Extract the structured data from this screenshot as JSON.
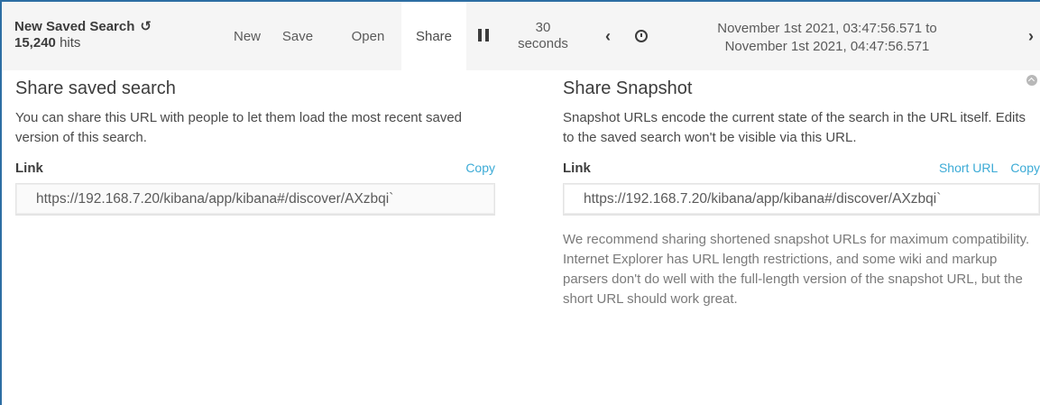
{
  "header": {
    "title": "New Saved Search",
    "hits_count": "15,240",
    "hits_label": "hits",
    "menu": {
      "new": "New",
      "save": "Save",
      "open": "Open",
      "share": "Share"
    },
    "interval_line1": "30",
    "interval_line2": "seconds",
    "time_from": "November 1st 2021, 03:47:56.571 to",
    "time_to": "November 1st 2021, 04:47:56.571"
  },
  "share_saved": {
    "title": "Share saved search",
    "description": "You can share this URL with people to let them load the most recent saved version of this search.",
    "link_label": "Link",
    "copy_label": "Copy",
    "url": "https://192.168.7.20/kibana/app/kibana#/discover/AXzbqi`"
  },
  "share_snapshot": {
    "title": "Share Snapshot",
    "description": "Snapshot URLs encode the current state of the search in the URL itself. Edits to the saved search won't be visible via this URL.",
    "link_label": "Link",
    "short_url_label": "Short URL",
    "copy_label": "Copy",
    "url": "https://192.168.7.20/kibana/app/kibana#/discover/AXzbqi`",
    "recommendation": "We recommend sharing shortened snapshot URLs for maximum compatibility. Internet Explorer has URL length restrictions, and some wiki and markup parsers don't do well with the full-length version of the snapshot URL, but the short URL should work great."
  },
  "colors": {
    "accent_link": "#3cabd6",
    "frame": "#2d6ea3",
    "navbar_bg": "#f5f5f5"
  }
}
